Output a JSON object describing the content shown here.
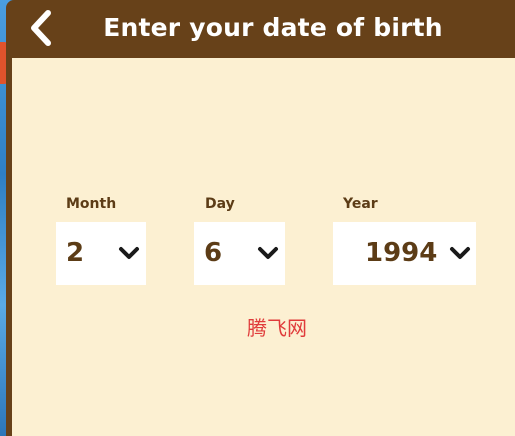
{
  "header": {
    "title": "Enter your date of birth",
    "back_icon": "chevron-left-icon"
  },
  "form": {
    "month": {
      "label": "Month",
      "value": "2"
    },
    "day": {
      "label": "Day",
      "value": "6"
    },
    "year": {
      "label": "Year",
      "value": "1994"
    },
    "dropdown_icon": "chevron-down-icon"
  },
  "watermark": "腾飞网",
  "colors": {
    "header_bg": "#674119",
    "content_bg": "#fcf0d2",
    "text": "#5c3c16",
    "watermark": "#e03b3b"
  }
}
